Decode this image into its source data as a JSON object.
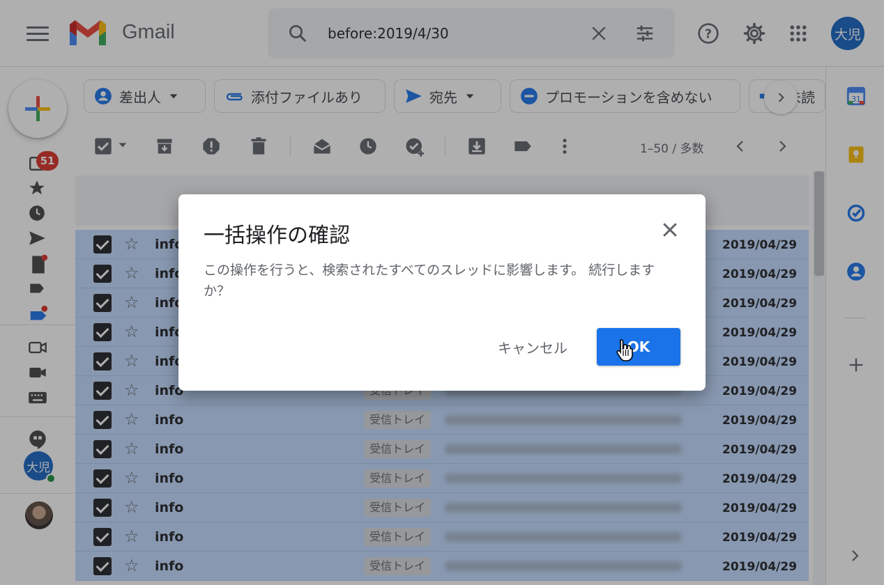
{
  "app": {
    "name": "Gmail"
  },
  "search": {
    "query": "before:2019/4/30"
  },
  "account": {
    "avatar_text": "大児"
  },
  "rail": {
    "inbox_badge": "51",
    "avatar_text": "大児"
  },
  "chips": [
    {
      "label": "差出人"
    },
    {
      "label": "添付ファイルあり"
    },
    {
      "label": "宛先"
    },
    {
      "label": "プロモーションを含めない"
    },
    {
      "label": "未読"
    }
  ],
  "toolbar": {
    "pager": "1–50 / 多数"
  },
  "rows": [
    {
      "sender": "info",
      "label": "",
      "date": "2019/04/29"
    },
    {
      "sender": "info",
      "label": "",
      "date": "2019/04/29"
    },
    {
      "sender": "info",
      "label": "",
      "date": "2019/04/29"
    },
    {
      "sender": "info",
      "label": "",
      "date": "2019/04/29"
    },
    {
      "sender": "info",
      "label": "",
      "date": "2019/04/29"
    },
    {
      "sender": "info",
      "label": "受信トレイ",
      "date": "2019/04/29"
    },
    {
      "sender": "info",
      "label": "受信トレイ",
      "date": "2019/04/29"
    },
    {
      "sender": "info",
      "label": "受信トレイ",
      "date": "2019/04/29"
    },
    {
      "sender": "info",
      "label": "受信トレイ",
      "date": "2019/04/29"
    },
    {
      "sender": "info",
      "label": "受信トレイ",
      "date": "2019/04/29"
    },
    {
      "sender": "info",
      "label": "受信トレイ",
      "date": "2019/04/29"
    },
    {
      "sender": "info",
      "label": "受信トレイ",
      "date": "2019/04/29"
    }
  ],
  "dialog": {
    "title": "一括操作の確認",
    "body": "この操作を行うと、検索されたすべてのスレッドに影響します。 続行しますか？",
    "cancel_label": "キャンセル",
    "ok_label": "OK"
  },
  "colors": {
    "accent": "#1a73e8",
    "selected_row": "#c2dbff",
    "badge": "#d93025"
  }
}
